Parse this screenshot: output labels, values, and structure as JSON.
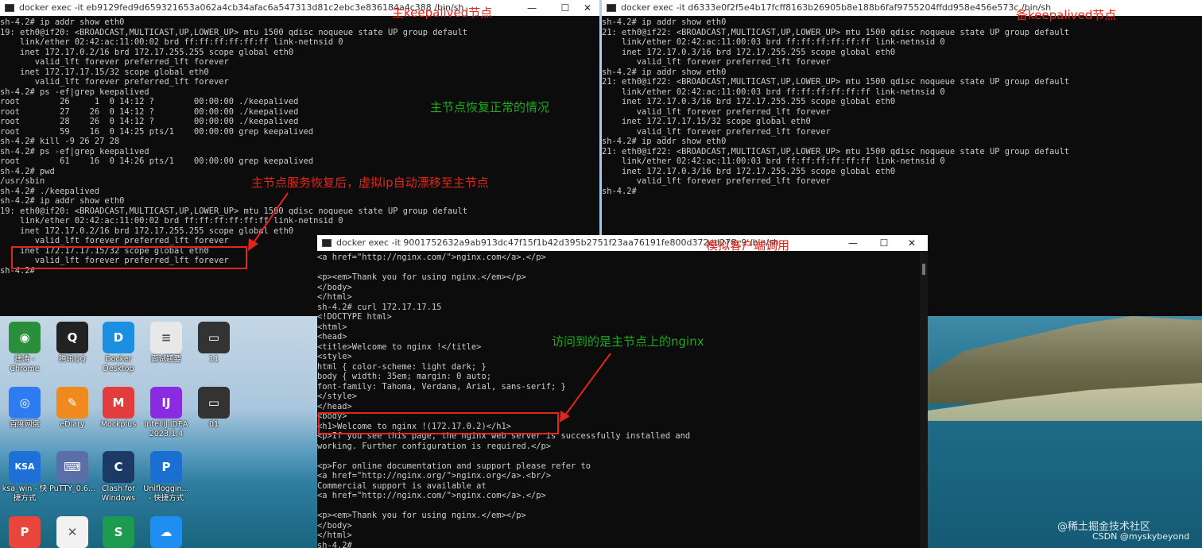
{
  "windows": {
    "primary": {
      "title": "docker exec -it eb9129fed9d659321653a062a4cb34afac6a547313d81c2ebc3e836184a4c388 /bin/sh",
      "lines": [
        "sh-4.2# ip addr show eth0",
        "19: eth0@if20: <BROADCAST,MULTICAST,UP,LOWER_UP> mtu 1500 qdisc noqueue state UP group default",
        "    link/ether 02:42:ac:11:00:02 brd ff:ff:ff:ff:ff:ff link-netnsid 0",
        "    inet 172.17.0.2/16 brd 172.17.255.255 scope global eth0",
        "       valid_lft forever preferred_lft forever",
        "    inet 172.17.17.15/32 scope global eth0",
        "       valid_lft forever preferred_lft forever",
        "sh-4.2# ps -ef|grep keepalived",
        "root        26     1  0 14:12 ?        00:00:00 ./keepalived",
        "root        27    26  0 14:12 ?        00:00:00 ./keepalived",
        "root        28    26  0 14:12 ?        00:00:00 ./keepalived",
        "root        59    16  0 14:25 pts/1    00:00:00 grep keepalived",
        "sh-4.2# kill -9 26 27 28",
        "sh-4.2# ps -ef|grep keepalived",
        "root        61    16  0 14:26 pts/1    00:00:00 grep keepalived",
        "sh-4.2# pwd",
        "/usr/sbin",
        "sh-4.2# ./keepalived",
        "sh-4.2# ip addr show eth0",
        "19: eth0@if20: <BROADCAST,MULTICAST,UP,LOWER_UP> mtu 1500 qdisc noqueue state UP group default",
        "    link/ether 02:42:ac:11:00:02 brd ff:ff:ff:ff:ff:ff link-netnsid 0",
        "    inet 172.17.0.2/16 brd 172.17.255.255 scope global eth0",
        "       valid_lft forever preferred_lft forever",
        "    inet 172.17.17.15/32 scope global eth0",
        "       valid_lft forever preferred_lft forever",
        "sh-4.2# "
      ]
    },
    "backup": {
      "title": "docker exec -it d6333e0f2f5e4b17fcff8163b26905b8e188b6faf9755204ffdd958e456e573c /bin/sh",
      "lines": [
        "sh-4.2# ip addr show eth0",
        "21: eth0@if22: <BROADCAST,MULTICAST,UP,LOWER_UP> mtu 1500 qdisc noqueue state UP group default",
        "    link/ether 02:42:ac:11:00:03 brd ff:ff:ff:ff:ff:ff link-netnsid 0",
        "    inet 172.17.0.3/16 brd 172.17.255.255 scope global eth0",
        "       valid_lft forever preferred_lft forever",
        "sh-4.2# ip addr show eth0",
        "21: eth0@if22: <BROADCAST,MULTICAST,UP,LOWER_UP> mtu 1500 qdisc noqueue state UP group default",
        "    link/ether 02:42:ac:11:00:03 brd ff:ff:ff:ff:ff:ff link-netnsid 0",
        "    inet 172.17.0.3/16 brd 172.17.255.255 scope global eth0",
        "       valid_lft forever preferred_lft forever",
        "    inet 172.17.17.15/32 scope global eth0",
        "       valid_lft forever preferred_lft forever",
        "sh-4.2# ip addr show eth0",
        "21: eth0@if22: <BROADCAST,MULTICAST,UP,LOWER_UP> mtu 1500 qdisc noqueue state UP group default",
        "    link/ether 02:42:ac:11:00:03 brd ff:ff:ff:ff:ff:ff link-netnsid 0",
        "    inet 172.17.0.3/16 brd 172.17.255.255 scope global eth0",
        "       valid_lft forever preferred_lft forever",
        "sh-4.2# "
      ]
    },
    "client": {
      "title": "docker exec -it 9001752632a9ab913dc47f15f1b42d395b2751f23aa76191fe800d372ed278c9 /bin/sh",
      "lines": [
        "<a href=\"http://nginx.com/\">nginx.com</a>.</p>",
        "",
        "<p><em>Thank you for using nginx.</em></p>",
        "</body>",
        "</html>",
        "sh-4.2# curl 172.17.17.15",
        "<!DOCTYPE html>",
        "<html>",
        "<head>",
        "<title>Welcome to nginx !</title>",
        "<style>",
        "html { color-scheme: light dark; }",
        "body { width: 35em; margin: 0 auto;",
        "font-family: Tahoma, Verdana, Arial, sans-serif; }",
        "</style>",
        "</head>",
        "<body>",
        "<h1>Welcome to nginx !(172.17.0.2)</h1>",
        "<p>If you see this page, the nginx web server is successfully installed and",
        "working. Further configuration is required.</p>",
        "",
        "<p>For online documentation and support please refer to",
        "<a href=\"http://nginx.org/\">nginx.org</a>.<br/>",
        "Commercial support is available at",
        "<a href=\"http://nginx.com/\">nginx.com</a>.</p>",
        "",
        "<p><em>Thank you for using nginx.</em></p>",
        "</body>",
        "</html>",
        "sh-4.2# "
      ]
    },
    "controls": {
      "minimize": "—",
      "maximize": "☐",
      "close": "✕"
    }
  },
  "annotations": {
    "primary_node": "主keepalived节点",
    "backup_node": "备keepalived节点",
    "primary_recovered": "主节点恢复正常的情况",
    "vip_float_back": "主节点服务恢复后，虚拟ip自动漂移至主节点",
    "simulate_client": "模拟客户端调用",
    "visited_primary": "访问到的是主节点上的nginx"
  },
  "colors": {
    "annotation_red": "#e3261c",
    "annotation_green": "#1fa81f",
    "terminal_bg": "#0c0c0c"
  },
  "desktop_icons": [
    {
      "label": "建涛 -\nChrome",
      "icon": "chrome-icon",
      "color": "#2a8f3a",
      "glyph": "◉"
    },
    {
      "label": "腾讯QQ",
      "icon": "qq-penguin-icon",
      "color": "#222222",
      "glyph": "Q"
    },
    {
      "label": "Docker\nDesktop",
      "icon": "docker-whale-icon",
      "color": "#1d8fe0",
      "glyph": "D"
    },
    {
      "label": "面试题要",
      "icon": "document-icon",
      "color": "#e8e8e8",
      "glyph": "≡"
    },
    {
      "label": "11",
      "icon": "screenshot-thumbnail-icon",
      "color": "#333333",
      "glyph": "▭"
    },
    {
      "label": "百度网盘",
      "icon": "baidu-netdisk-icon",
      "color": "#2f7bf2",
      "glyph": "◎"
    },
    {
      "label": "eDiary",
      "icon": "ediary-icon",
      "color": "#f08a1e",
      "glyph": "✎"
    },
    {
      "label": "Mockplus",
      "icon": "mockplus-icon",
      "color": "#e23c3c",
      "glyph": "M"
    },
    {
      "label": "IntelliJ IDEA\n2023.1.4",
      "icon": "intellij-idea-icon",
      "color": "#8a2be2",
      "glyph": "IJ"
    },
    {
      "label": "01",
      "icon": "screenshot-thumbnail-icon",
      "color": "#333333",
      "glyph": "▭"
    },
    {
      "label": "ksa_win - 快\n捷方式",
      "icon": "ksa-icon",
      "color": "#1e6fd8",
      "glyph": "KSA"
    },
    {
      "label": "PuTTY_0.6...",
      "icon": "putty-icon",
      "color": "#5a6fa8",
      "glyph": "⌨"
    },
    {
      "label": "Clash for\nWindows",
      "icon": "clash-cat-icon",
      "color": "#1c3a66",
      "glyph": "C"
    },
    {
      "label": "Unifloggin...\n- 快捷方式",
      "icon": "unifloggin-icon",
      "color": "#1a6fd0",
      "glyph": "P"
    },
    {
      "label": "",
      "icon": "wps-pdf-icon",
      "color": "#e8453c",
      "glyph": "P"
    },
    {
      "label": "",
      "icon": "xmind-icon",
      "color": "#f2f2f2",
      "glyph": "✕"
    },
    {
      "label": "",
      "icon": "spreadsheet-icon",
      "color": "#1c9a4f",
      "glyph": "S"
    },
    {
      "label": "",
      "icon": "cloud-sync-icon",
      "color": "#1e8ff0",
      "glyph": "☁"
    }
  ],
  "watermark": {
    "line1": "@稀土掘金技术社区",
    "line2": "CSDN @myskybeyond"
  }
}
